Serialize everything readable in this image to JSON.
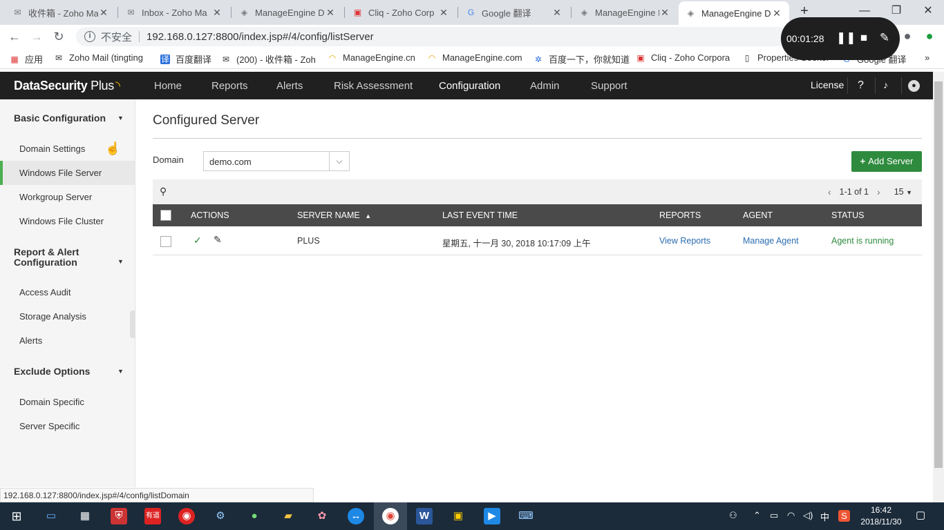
{
  "browser": {
    "tabs": [
      {
        "title": "收件箱 - Zoho Ma",
        "icon": "mail-icon"
      },
      {
        "title": "Inbox - Zoho Ma",
        "icon": "mail-icon"
      },
      {
        "title": "ManageEngine D",
        "icon": "manageengine-icon"
      },
      {
        "title": "Cliq - Zoho Corp",
        "icon": "cliq-icon"
      },
      {
        "title": "Google 翻译",
        "icon": "google-translate-icon"
      },
      {
        "title": "ManageEngine D",
        "icon": "manageengine-icon"
      },
      {
        "title": "ManageEngine D",
        "icon": "manageengine-icon",
        "active": true
      }
    ],
    "new_tab": "+",
    "address": {
      "security_label": "不安全",
      "url": "192.168.0.127:8800/index.jsp#/4/config/listServer"
    },
    "bookmarks": [
      {
        "label": "应用",
        "icon": "apps-grid-icon"
      },
      {
        "label": "Zoho Mail (tingting",
        "icon": "mail-icon"
      },
      {
        "label": "百度翻译",
        "icon": "baidu-translate-icon"
      },
      {
        "label": "(200) - 收件箱 - Zoh",
        "icon": "mail-icon"
      },
      {
        "label": "ManageEngine.cn",
        "icon": "manageengine-icon"
      },
      {
        "label": "ManageEngine.com",
        "icon": "manageengine-icon"
      },
      {
        "label": "百度一下，你就知道",
        "icon": "baidu-paw-icon"
      },
      {
        "label": "Cliq - Zoho Corpora",
        "icon": "cliq-icon"
      },
      {
        "label": "Properties Seeker",
        "icon": "page-icon"
      },
      {
        "label": "Google 翻译",
        "icon": "google-translate-icon"
      }
    ],
    "bookmarks_more": "»"
  },
  "recorder": {
    "time": "00:01:28"
  },
  "app": {
    "logo_main": "DataSecurity",
    "logo_plus": "Plus",
    "nav": [
      "Home",
      "Reports",
      "Alerts",
      "Risk Assessment",
      "Configuration",
      "Admin",
      "Support"
    ],
    "active_nav": "Configuration",
    "license": "License",
    "help": "?"
  },
  "sidebar": {
    "sections": [
      {
        "title": "Basic Configuration",
        "items": [
          "Domain Settings",
          "Windows File Server",
          "Workgroup Server",
          "Windows File Cluster"
        ]
      },
      {
        "title": "Report & Alert Configuration",
        "items": [
          "Access Audit",
          "Storage Analysis",
          "Alerts"
        ]
      },
      {
        "title": "Exclude Options",
        "items": [
          "Domain Specific",
          "Server Specific"
        ]
      }
    ],
    "active_item": "Windows File Server"
  },
  "main": {
    "title": "Configured Server",
    "domain_label": "Domain",
    "domain_value": "demo.com",
    "add_button": "Add Server",
    "pager": {
      "range": "1-1 of 1",
      "per_page": "15"
    },
    "table": {
      "headers": [
        "ACTIONS",
        "SERVER NAME",
        "LAST EVENT TIME",
        "REPORTS",
        "AGENT",
        "STATUS"
      ],
      "rows": [
        {
          "server_name": "PLUS",
          "last_event_time": "星期五, 十一月 30, 2018 10:17:09 上午",
          "reports": "View Reports",
          "agent": "Manage Agent",
          "status": "Agent is running"
        }
      ]
    }
  },
  "status_url": "192.168.0.127:8800/index.jsp#/4/config/listDomain",
  "taskbar": {
    "time": "16:42",
    "date": "2018/11/30",
    "ime": "中"
  },
  "colors": {
    "header_bg": "#202020",
    "accent_green": "#2e8b3e",
    "link_blue": "#2b6cb0"
  }
}
